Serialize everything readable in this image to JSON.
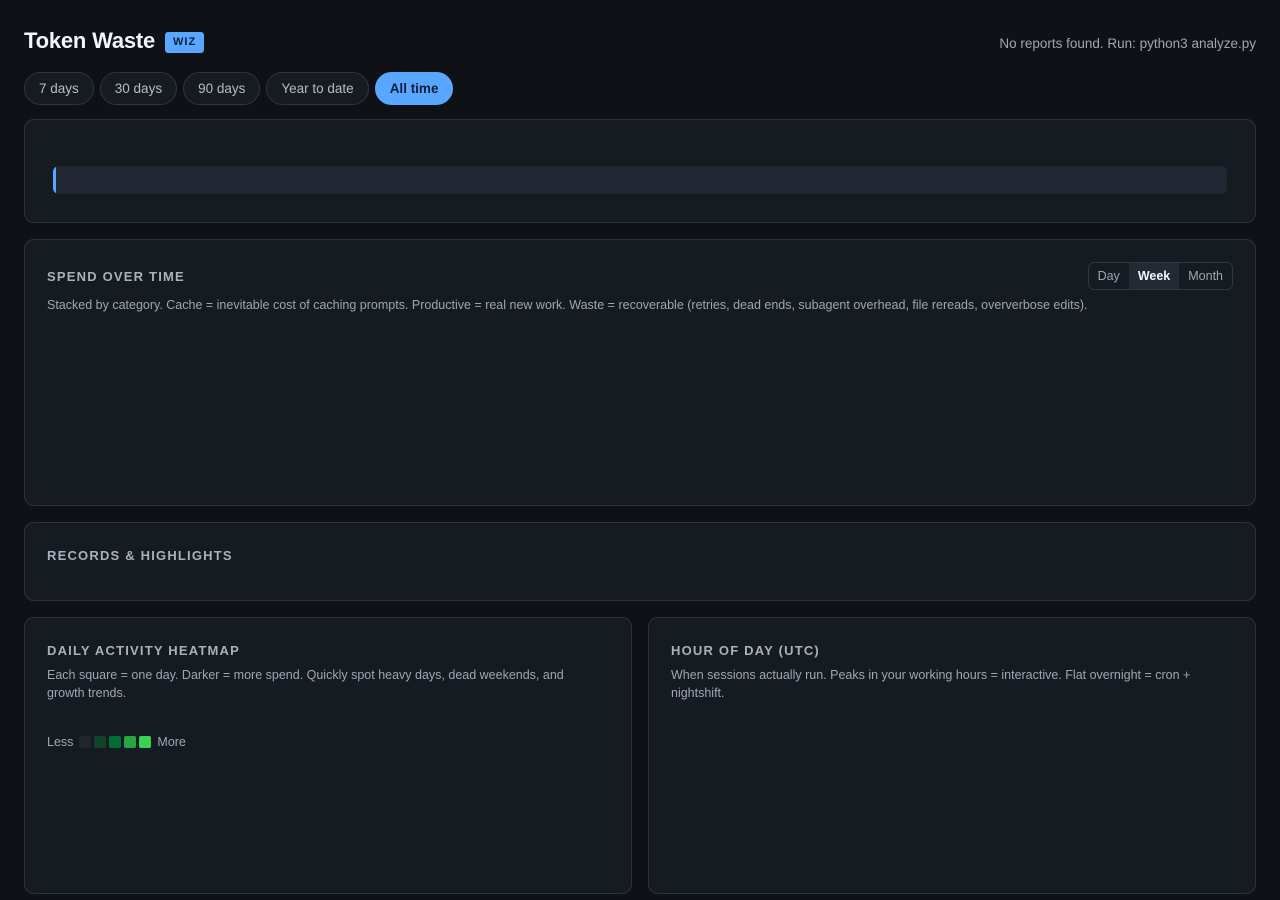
{
  "header": {
    "title": "Token Waste",
    "badge": "WIZ",
    "status": "No reports found. Run: python3 analyze.py"
  },
  "range_tabs": [
    {
      "label": "7 days",
      "active": false
    },
    {
      "label": "30 days",
      "active": false
    },
    {
      "label": "90 days",
      "active": false
    },
    {
      "label": "Year to date",
      "active": false
    },
    {
      "label": "All time",
      "active": true
    }
  ],
  "progress": {
    "value": 0
  },
  "spend": {
    "title": "SPEND OVER TIME",
    "description": "Stacked by category. Cache = inevitable cost of caching prompts. Productive = real new work. Waste = recoverable (retries, dead ends, subagent overhead, file rereads, oververbose edits).",
    "granularity": [
      {
        "label": "Day",
        "active": false
      },
      {
        "label": "Week",
        "active": true
      },
      {
        "label": "Month",
        "active": false
      }
    ]
  },
  "records": {
    "title": "RECORDS & HIGHLIGHTS"
  },
  "heatmap": {
    "title": "DAILY ACTIVITY HEATMAP",
    "description": "Each square = one day. Darker = more spend. Quickly spot heavy days, dead weekends, and growth trends.",
    "legend_less": "Less",
    "legend_more": "More",
    "legend_colors": [
      "#21262d",
      "#0e4429",
      "#006d32",
      "#26a641",
      "#39d353"
    ]
  },
  "hour_of_day": {
    "title": "HOUR OF DAY (UTC)",
    "description": "When sessions actually run. Peaks in your working hours = interactive. Flat overnight = cron + nightshift."
  },
  "colors": {
    "accent": "#58a6ff",
    "background": "#0e1116",
    "card": "#161a21"
  }
}
